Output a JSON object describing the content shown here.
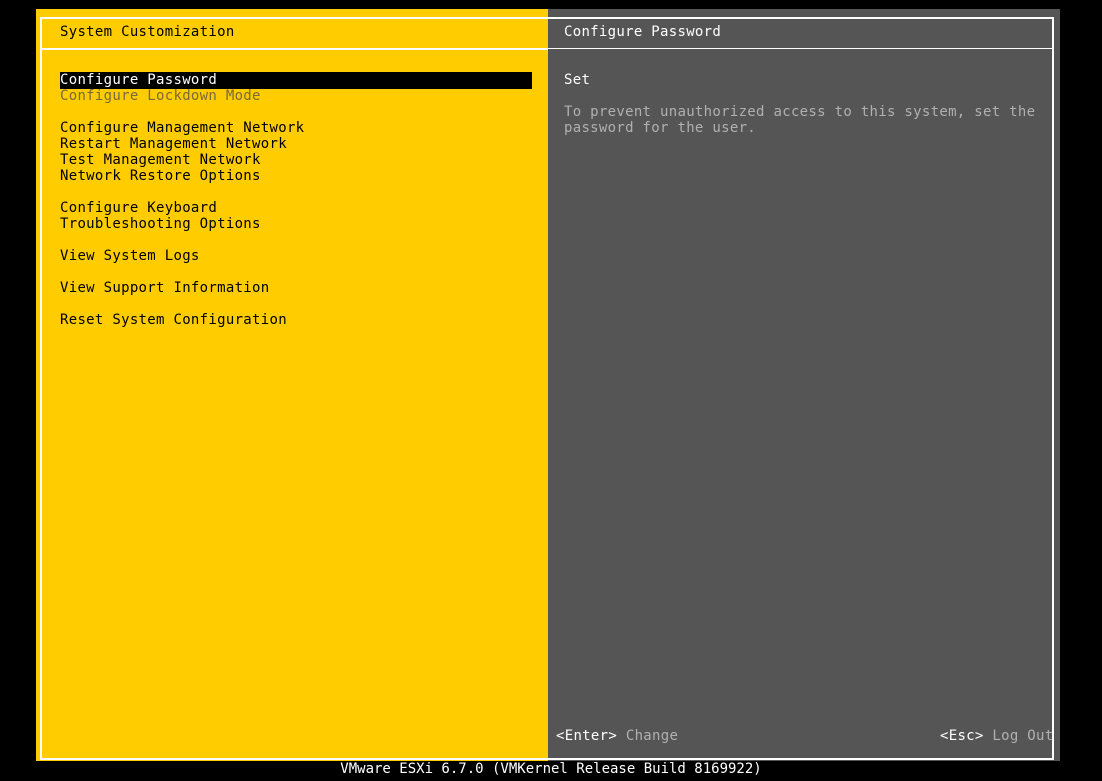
{
  "left_panel": {
    "title": "System Customization",
    "menu": [
      {
        "label": "Configure Password",
        "state": "selected"
      },
      {
        "label": "Configure Lockdown Mode",
        "state": "disabled"
      },
      {
        "label": "Configure Management Network",
        "state": "normal"
      },
      {
        "label": "Restart Management Network",
        "state": "normal"
      },
      {
        "label": "Test Management Network",
        "state": "normal"
      },
      {
        "label": "Network Restore Options",
        "state": "normal"
      },
      {
        "label": "Configure Keyboard",
        "state": "normal"
      },
      {
        "label": "Troubleshooting Options",
        "state": "normal"
      },
      {
        "label": "View System Logs",
        "state": "normal"
      },
      {
        "label": "View Support Information",
        "state": "normal"
      },
      {
        "label": "Reset System Configuration",
        "state": "normal"
      }
    ]
  },
  "right_panel": {
    "title": "Configure Password",
    "status": "Set",
    "description_line1": "To prevent unauthorized access to this system, set the",
    "description_line2": "password for the user."
  },
  "footer": {
    "enter_key": "<Enter>",
    "enter_action": "Change",
    "esc_key": "<Esc>",
    "esc_action": "Log Out",
    "build_info": "VMware ESXi 6.7.0 (VMKernel Release Build 8169922)"
  },
  "colors": {
    "left_panel_bg": "#ffcc00",
    "right_panel_bg": "#555555",
    "screen_bg": "#000000"
  }
}
